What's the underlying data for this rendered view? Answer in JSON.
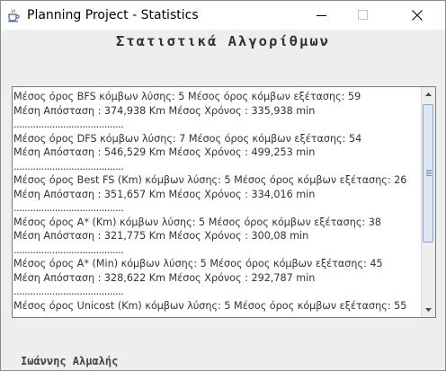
{
  "window": {
    "title": "Planning Project - Statistics",
    "app_icon": "java-cup-icon",
    "controls": [
      "minimize-icon",
      "maximize-icon",
      "close-icon"
    ]
  },
  "heading": "Στατιστικά Αλγορίθμων",
  "results": [
    {
      "line1": "Μέσος όρος  BFS κόμβων λύσης: 5  Μέσος όρος κόμβων εξέτασης: 59",
      "line2": "Μέση Απόσταση : 374,938 Km   Μέσος Χρόνος : 335,938 min",
      "separator": "........................................"
    },
    {
      "line1": "Μέσος όρος  DFS κόμβων λύσης: 7  Μέσος όρος κόμβων εξέτασης: 54",
      "line2": "Μέση Απόσταση : 546,529 Km   Μέσος Χρόνος : 499,253 min",
      "separator": "........................................"
    },
    {
      "line1": "Μέσος όρος  Best FS (Km) κόμβων λύσης: 5  Μέσος όρος κόμβων εξέτασης: 26",
      "line2": "Μέση Απόσταση : 351,657 Km   Μέσος Χρόνος : 334,016 min",
      "separator": "........................................"
    },
    {
      "line1": "Μέσος όρος  A* (Km) κόμβων λύσης: 5  Μέσος όρος κόμβων εξέτασης: 38",
      "line2": "Μέση Απόσταση : 321,775 Km   Μέσος Χρόνος : 300,08 min",
      "separator": "........................................"
    },
    {
      "line1": "Μέσος όρος  A* (Min) κόμβων λύσης: 5  Μέσος όρος κόμβων εξέτασης: 45",
      "line2": "Μέση Απόσταση : 328,622 Km   Μέσος Χρόνος : 292,787 min",
      "separator": "........................................"
    },
    {
      "line1": "Μέσος όρος  Unicost (Km) κόμβων λύσης: 5  Μέσος όρος κόμβων εξέτασης: 55"
    }
  ],
  "scrollbar": {
    "position_fraction": 0.0
  },
  "author": "Ιωάννης Αλμαλής"
}
